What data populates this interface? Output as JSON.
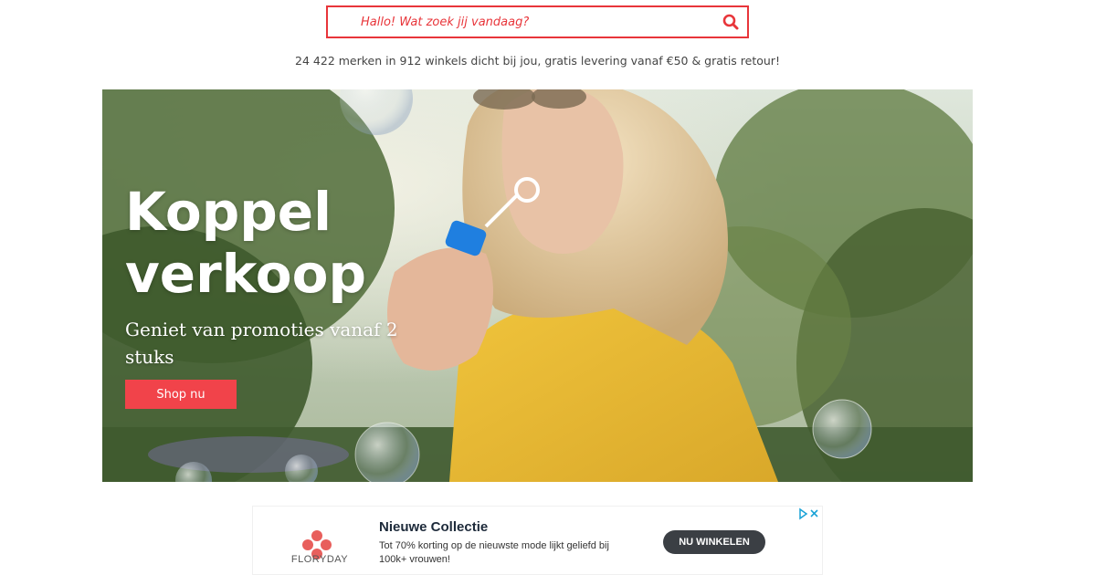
{
  "search": {
    "placeholder": "Hallo! Wat zoek jij vandaag?",
    "icon": "search-icon"
  },
  "tagline": "24 422 merken in 912 winkels dicht bij jou, gratis levering vanaf €50 & gratis retour!",
  "hero": {
    "title": "Koppel\nverkoop",
    "subtitle": "Geniet van promoties vanaf 2 stuks",
    "button_label": "Shop nu"
  },
  "ad": {
    "brand": "FLORYDAY",
    "title": "Nieuwe Collectie",
    "description": "Tot 70% korting op de nieuwste mode lijkt geliefd bij 100k+ vrouwen!",
    "cta_label": "NU WINKELEN"
  },
  "colors": {
    "accent": "#e8353a",
    "shop_button": "#f1434a",
    "cta_button": "#3b3f44"
  }
}
